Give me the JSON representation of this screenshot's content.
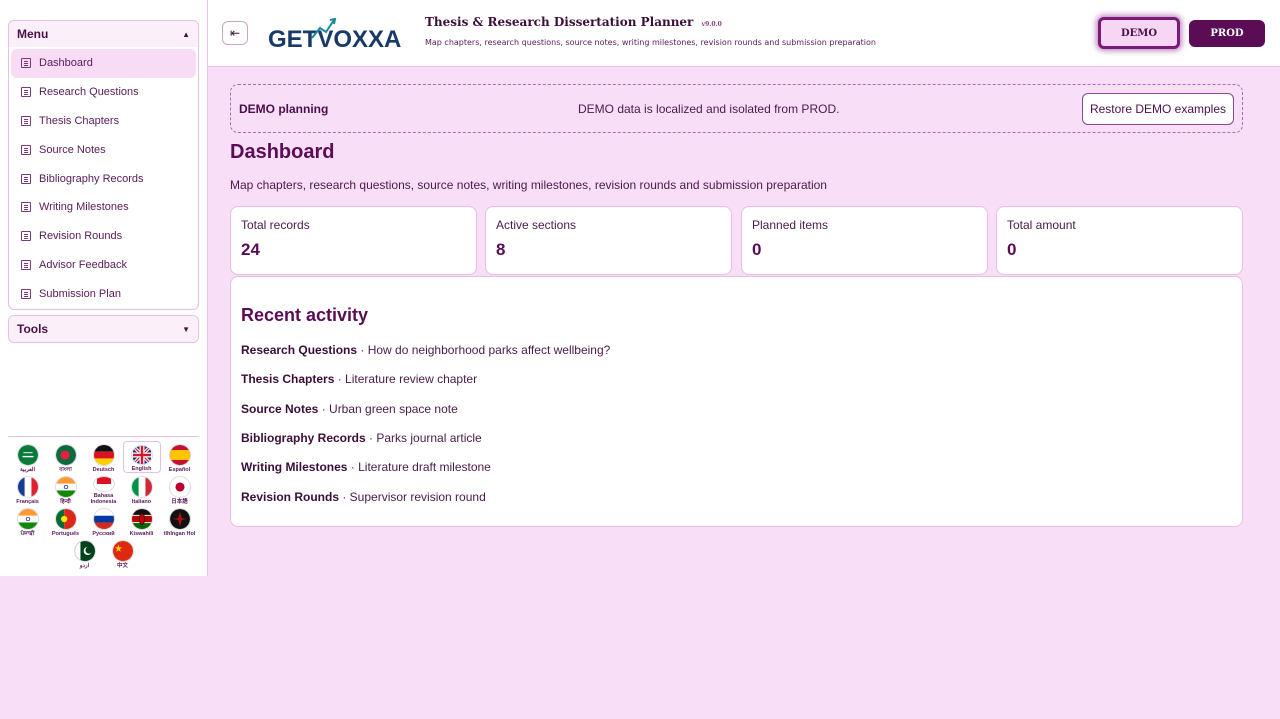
{
  "sidebar": {
    "menu_title": "Menu",
    "tools_title": "Tools",
    "items": [
      {
        "label": "Dashboard"
      },
      {
        "label": "Research Questions"
      },
      {
        "label": "Thesis Chapters"
      },
      {
        "label": "Source Notes"
      },
      {
        "label": "Bibliography Records"
      },
      {
        "label": "Writing Milestones"
      },
      {
        "label": "Revision Rounds"
      },
      {
        "label": "Advisor Feedback"
      },
      {
        "label": "Submission Plan"
      }
    ],
    "languages": [
      {
        "label": "العربية"
      },
      {
        "label": "বাংলা"
      },
      {
        "label": "Deutsch"
      },
      {
        "label": "English"
      },
      {
        "label": "Español"
      },
      {
        "label": "Français"
      },
      {
        "label": "हिन्दी"
      },
      {
        "label": "Bahasa Indonesia"
      },
      {
        "label": "Italiano"
      },
      {
        "label": "日本語"
      },
      {
        "label": "ਪੰਜਾਬੀ"
      },
      {
        "label": "Português"
      },
      {
        "label": "Русский"
      },
      {
        "label": "Kiswahili"
      },
      {
        "label": "tlhIngan Hol"
      },
      {
        "label": "اردو"
      },
      {
        "label": "中文"
      }
    ]
  },
  "header": {
    "logo_text": "GETVOXXA",
    "title": "Thesis & Research Dissertation Planner",
    "version": "v9.0.0",
    "subtitle": "Map chapters, research questions, source notes, writing milestones, revision rounds and submission preparation",
    "demo_label": "DEMO",
    "prod_label": "PROD"
  },
  "banner": {
    "title": "DEMO planning",
    "message": "DEMO data is localized and isolated from PROD.",
    "restore_label": "Restore DEMO examples"
  },
  "main": {
    "title": "Dashboard",
    "subtitle": "Map chapters, research questions, source notes, writing milestones, revision rounds and submission preparation",
    "stats": [
      {
        "label": "Total records",
        "value": "24"
      },
      {
        "label": "Active sections",
        "value": "8"
      },
      {
        "label": "Planned items",
        "value": "0"
      },
      {
        "label": "Total amount",
        "value": "0"
      }
    ],
    "activity_title": "Recent activity",
    "activity": [
      {
        "section": "Research Questions",
        "text": " · How do neighborhood parks affect wellbeing?"
      },
      {
        "section": "Thesis Chapters",
        "text": " · Literature review chapter"
      },
      {
        "section": "Source Notes",
        "text": " · Urban green space note"
      },
      {
        "section": "Bibliography Records",
        "text": " · Parks journal article"
      },
      {
        "section": "Writing Milestones",
        "text": " · Literature draft milestone"
      },
      {
        "section": "Revision Rounds",
        "text": " · Supervisor revision round"
      }
    ]
  },
  "colors": {
    "accent": "#5a0d55",
    "background": "#f8def7"
  }
}
